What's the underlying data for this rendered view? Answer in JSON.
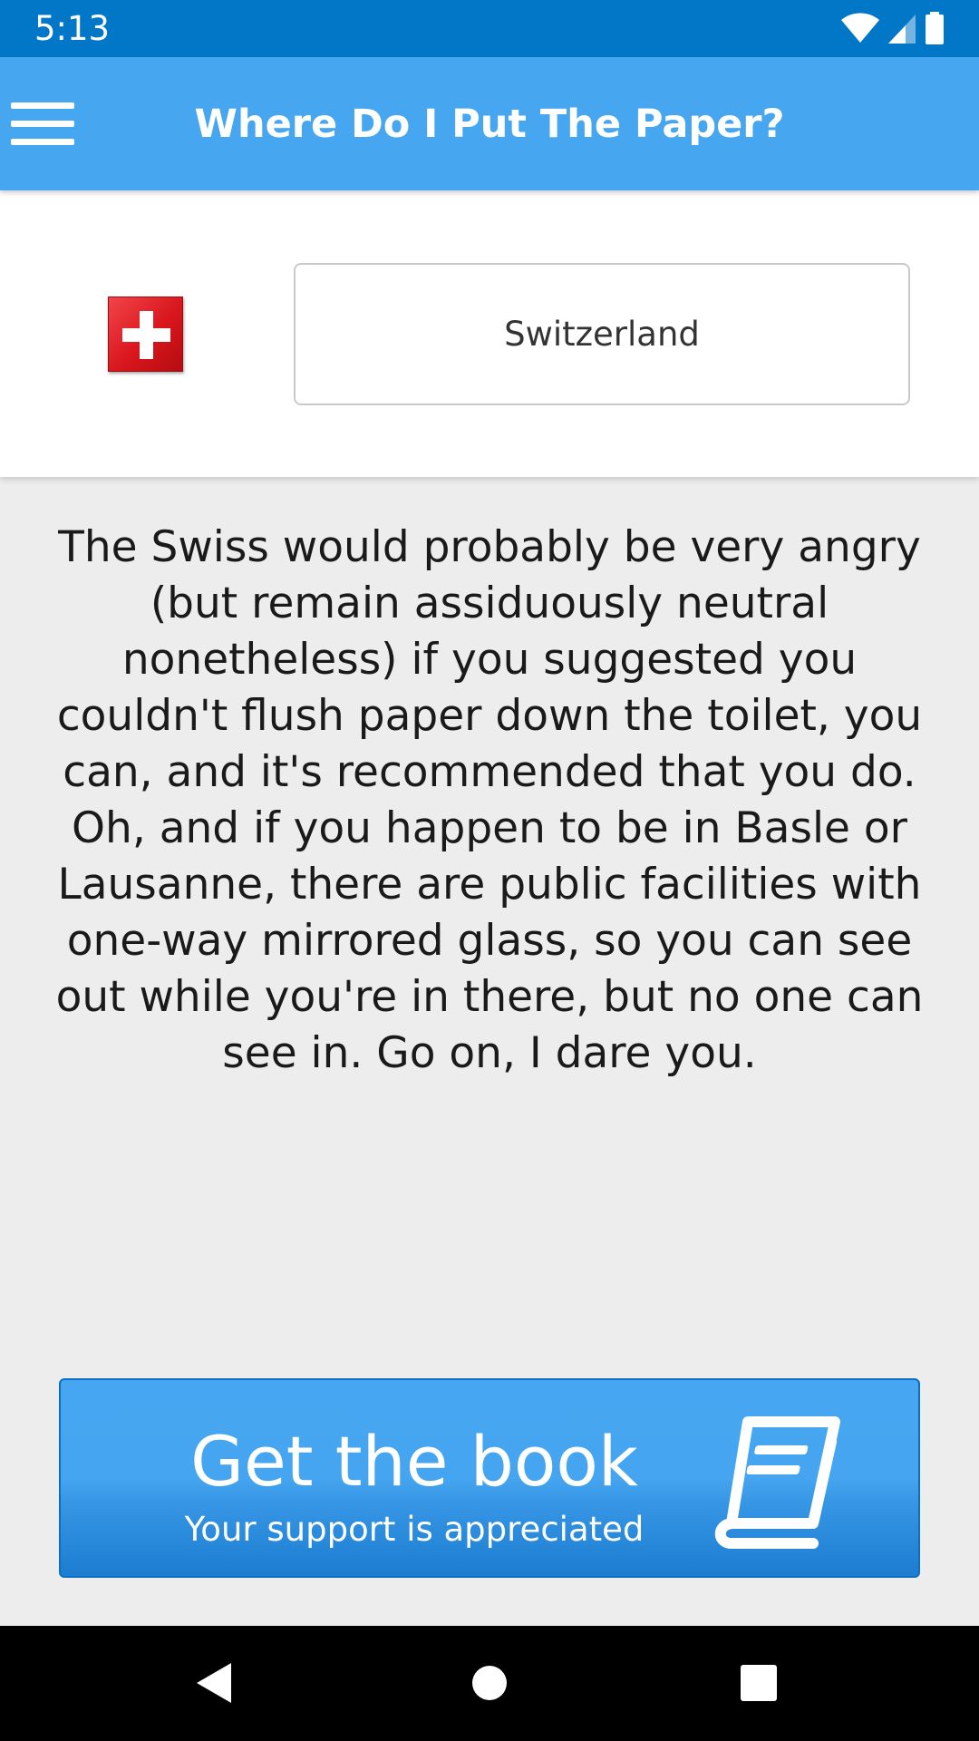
{
  "status_bar": {
    "time": "5:13",
    "icons": [
      "wifi-icon",
      "cell-signal-icon",
      "battery-icon"
    ]
  },
  "app_bar": {
    "title": "Where Do I Put The Paper?",
    "menu_icon": "hamburger-menu-icon",
    "color": "#47a6f0"
  },
  "country": {
    "name": "Switzerland",
    "flag_icon": "swiss-flag-icon"
  },
  "description": "The Swiss would probably be very angry (but remain assiduously neutral nonetheless) if you suggested you couldn't flush paper down the toilet, you can, and it's recommended that you do. Oh, and if you happen to be in Basle or Lausanne, there are public facilities with one-way mirrored glass, so you can see out while you're in there, but no one can see in. Go on, I dare you.",
  "book_button": {
    "title": "Get the book",
    "subtitle": "Your support is appreciated",
    "icon": "book-icon"
  },
  "nav_bar": {
    "buttons": [
      "back-icon",
      "home-icon",
      "recents-icon"
    ]
  },
  "colors": {
    "status_bar": "#0277c8",
    "app_bar": "#47a6f0",
    "background": "#ededed",
    "button": "#45a5f0"
  }
}
